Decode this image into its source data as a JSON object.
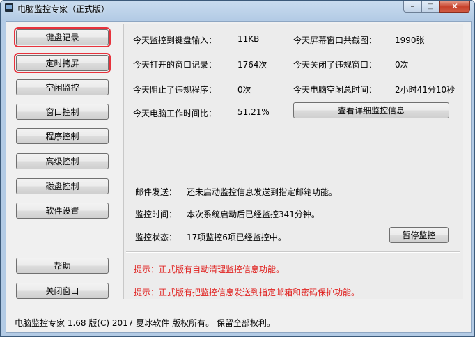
{
  "window": {
    "title": "电脑监控专家（正式版）",
    "caption": {
      "minimize": "–",
      "maximize": "□",
      "close": "✕"
    }
  },
  "sidebar": {
    "items": [
      {
        "label": "键盘记录"
      },
      {
        "label": "定时拷屏"
      },
      {
        "label": "空闲监控"
      },
      {
        "label": "窗口控制"
      },
      {
        "label": "程序控制"
      },
      {
        "label": "高级控制"
      },
      {
        "label": "磁盘控制"
      },
      {
        "label": "软件设置"
      }
    ],
    "help": "帮助",
    "close": "关闭窗口"
  },
  "stats": {
    "keyboard_label": "今天监控到键盘输入：",
    "keyboard_value": "11KB",
    "screenshot_label": "今天屏幕窗口共截图：",
    "screenshot_value": "1990张",
    "windows_label": "今天打开的窗口记录：",
    "windows_value": "1764次",
    "closed_label": "今天关闭了违规窗口：",
    "closed_value": "0次",
    "blocked_label": "今天阻止了违规程序：",
    "blocked_value": "0次",
    "idle_label": "今天电脑空闲总时间：",
    "idle_value": "2小时41分10秒",
    "ratio_label": "今天电脑工作时间比：",
    "ratio_value": "51.21%",
    "details_button": "查看详细监控信息"
  },
  "info": {
    "mail_label": "邮件发送：",
    "mail_value": "还未启动监控信息发送到指定邮箱功能。",
    "time_label": "监控时间：",
    "time_value": "本次系统启动后已经监控341分钟。",
    "status_label": "监控状态：",
    "status_value": "17项监控6项已经监控中。",
    "pause_button": "暂停监控"
  },
  "tips": [
    "提示：正式版有自动清理监控信息功能。",
    "提示：正式版有把监控信息发送到指定邮箱和密码保护功能。"
  ],
  "statusbar": "电脑监控专家 1.68 版(C) 2017 夏冰软件 版权所有。 保留全部权利。",
  "colors": {
    "tip": "#e0201e",
    "highlight": "#e8323c"
  }
}
